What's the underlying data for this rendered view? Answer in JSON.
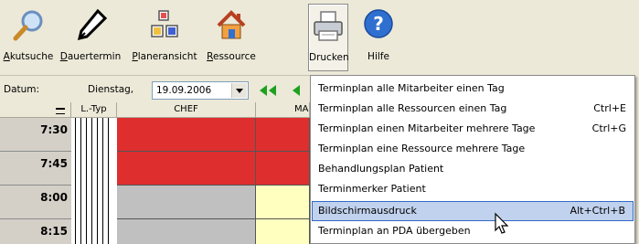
{
  "toolbar": {
    "buttons": [
      {
        "id": "akutsuche",
        "ul": "A",
        "rest": "kutsuche",
        "icon": "magnifier-icon"
      },
      {
        "id": "dauertermin",
        "ul": "D",
        "rest": "auertermin",
        "icon": "pen-icon"
      },
      {
        "id": "planeransicht",
        "ul": "P",
        "rest": "laneransicht",
        "icon": "grid-view-icon"
      },
      {
        "id": "ressource",
        "ul": "R",
        "rest": "essource",
        "icon": "house-icon"
      },
      {
        "id": "drucken",
        "ul": "",
        "rest": "Drucken",
        "icon": "printer-icon"
      },
      {
        "id": "hilfe",
        "ul": "",
        "rest": "Hilfe",
        "icon": "help-icon"
      }
    ]
  },
  "datebar": {
    "label": "Datum:",
    "day": "Dienstag,",
    "date": "19.09.2006"
  },
  "grid": {
    "headers": {
      "type": "L.-Typ",
      "chef": "CHEF",
      "ma": "MA"
    },
    "times": [
      "7:30",
      "7:45",
      "8:00",
      "8:15"
    ]
  },
  "menu": {
    "items": [
      {
        "label": "Terminplan alle Mitarbeiter einen Tag",
        "shortcut": ""
      },
      {
        "label": "Terminplan alle Ressourcen einen Tag",
        "shortcut": "Ctrl+E"
      },
      {
        "label": "Terminplan einen Mitarbeiter mehrere Tage",
        "shortcut": "Ctrl+G"
      },
      {
        "label": "Terminplan eine Ressource mehrere Tage",
        "shortcut": ""
      },
      {
        "label": "Behandlungsplan Patient",
        "shortcut": ""
      },
      {
        "label": "Terminmerker Patient",
        "shortcut": ""
      },
      {
        "label": "Bildschirmausdruck",
        "shortcut": "Alt+Ctrl+B"
      },
      {
        "label": "Terminplan an PDA übergeben",
        "shortcut": ""
      }
    ]
  },
  "colors": {
    "appointment_red": "#de2e2e",
    "cell_gray": "#c0c0c0",
    "cell_yellow": "#ffffc0",
    "menu_highlight": "#c1d2ee"
  }
}
